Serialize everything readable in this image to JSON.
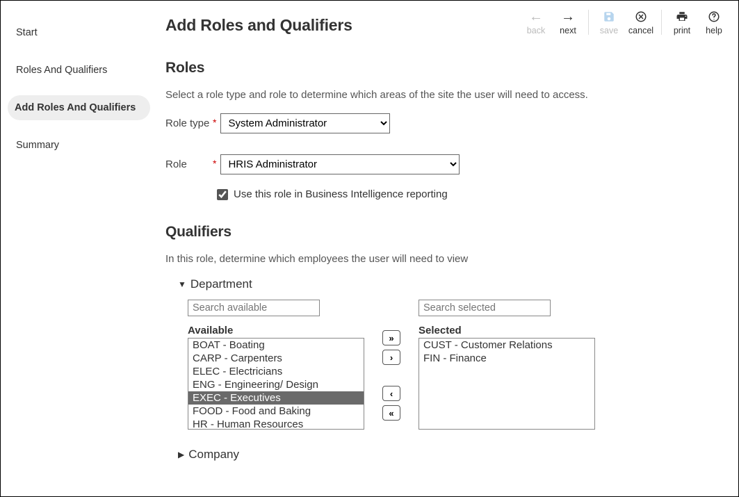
{
  "nav": {
    "items": [
      {
        "label": "Start",
        "active": false
      },
      {
        "label": "Roles And Qualifiers",
        "active": false
      },
      {
        "label": "Add Roles And Qualifiers",
        "active": true
      },
      {
        "label": "Summary",
        "active": false
      }
    ]
  },
  "toolbar": {
    "back": "back",
    "next": "next",
    "save": "save",
    "cancel": "cancel",
    "print": "print",
    "help": "help"
  },
  "page": {
    "title": "Add Roles and Qualifiers",
    "roles_heading": "Roles",
    "roles_help": "Select a role type and role to determine which areas of the site the user will need to access.",
    "roletype_label": "Role type",
    "roletype_value": "System Administrator",
    "role_label": "Role",
    "role_value": "HRIS Administrator",
    "bi_checkbox_label": "Use this role in Business Intelligence reporting",
    "bi_checked": true,
    "qualifiers_heading": "Qualifiers",
    "qualifiers_help": "In this role, determine which employees the user will need to view",
    "department_label": "Department",
    "company_label": "Company",
    "search_available_placeholder": "Search available",
    "search_selected_placeholder": "Search selected",
    "available_label": "Available",
    "selected_label": "Selected",
    "available_items": [
      "BOAT - Boating",
      "CARP - Carpenters",
      "ELEC - Electricians",
      "ENG - Engineering/ Design",
      "EXEC - Executives",
      "FOOD - Food and Baking",
      "HR - Human Resources"
    ],
    "available_highlight_index": 4,
    "selected_items": [
      "CUST - Customer Relations",
      "FIN - Finance"
    ]
  }
}
